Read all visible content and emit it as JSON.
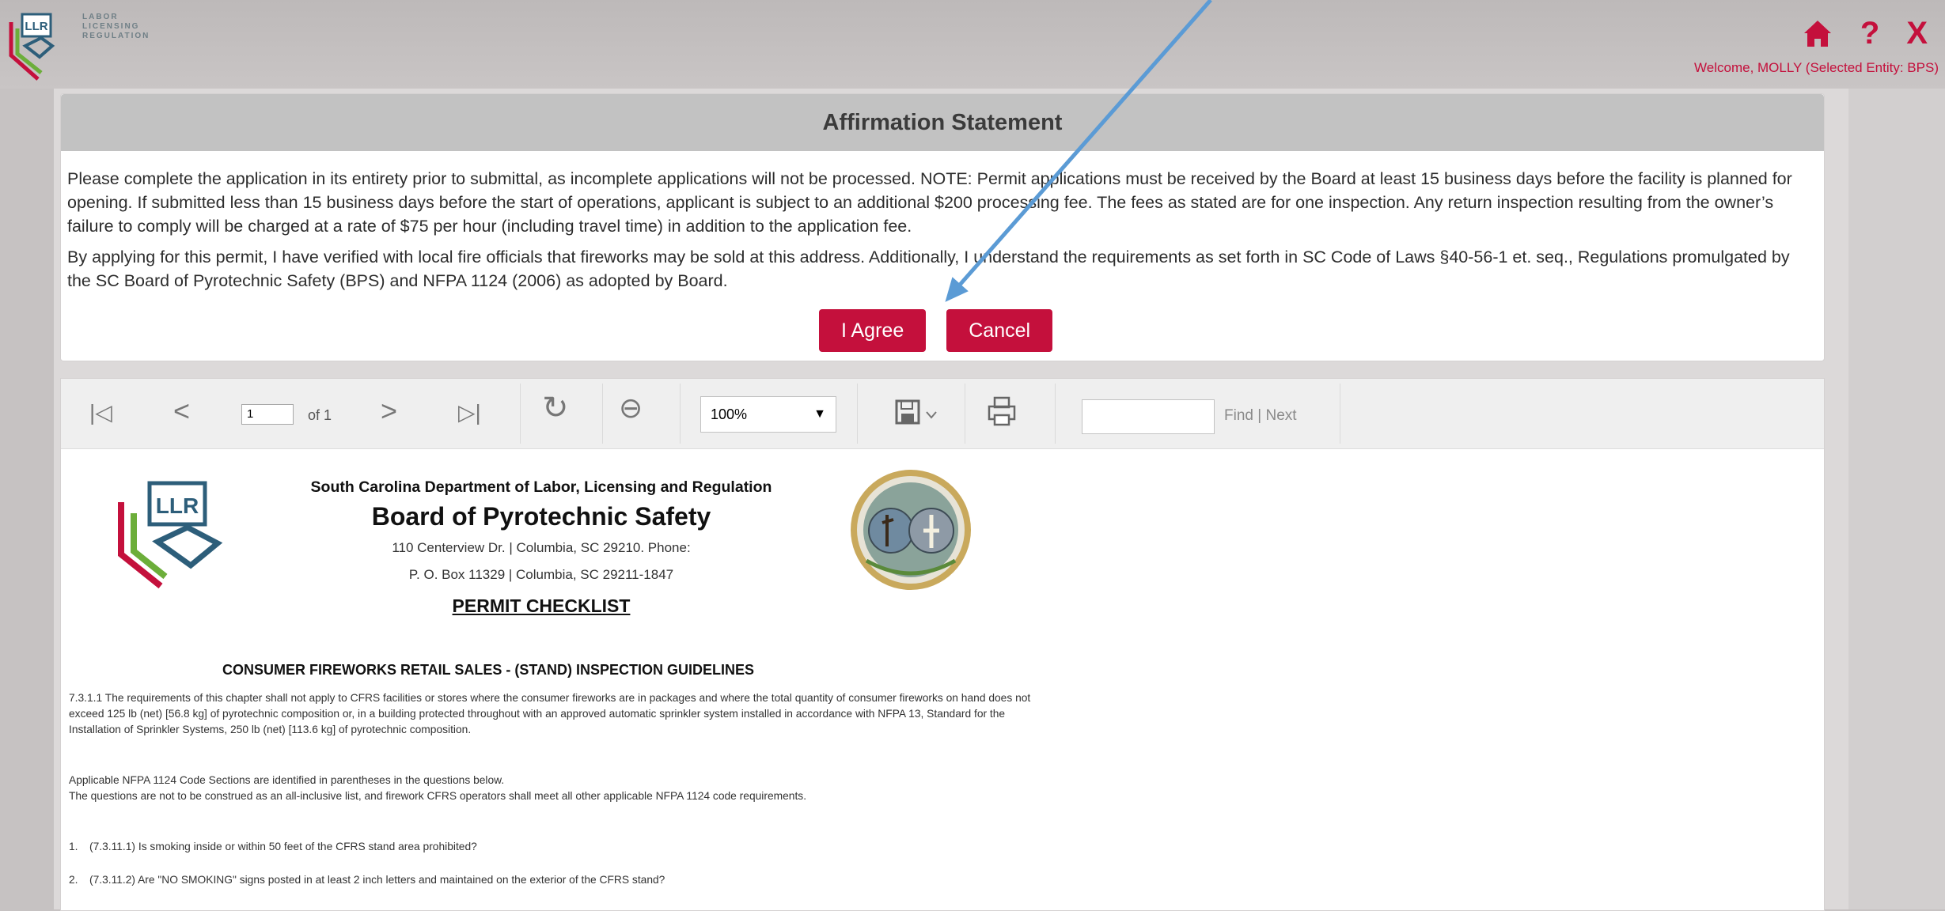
{
  "brand": {
    "logo_text": "LLR",
    "wordmark": "LABOR\nLICENSING\nREGULATION"
  },
  "header": {
    "home_icon": "home-icon",
    "help_symbol": "?",
    "close_symbol": "X",
    "welcome": "Welcome, MOLLY (Selected Entity: BPS)"
  },
  "affirmation": {
    "title": "Affirmation Statement",
    "paragraph1": "Please complete the application in its entirety prior to submittal, as incomplete applications will not be processed. NOTE: Permit applications must be received by the Board at least 15 business days before the facility is planned for opening. If submitted less than 15 business days before the start of operations, applicant is subject to an additional $200 processing fee. The fees as stated are for one inspection. Any return inspection resulting from the owner’s failure to comply will be charged at a rate of $75 per hour (including travel time) in addition to the application fee.",
    "paragraph2": "By applying for this permit, I have verified with local fire officials that fireworks may be sold at this address. Additionally, I understand the requirements as set forth in SC Code of Laws §40-56-1 et. seq., Regulations promulgated by the SC Board of Pyrotechnic Safety (BPS) and NFPA 1124 (2006) as adopted by Board.",
    "agree_label": "I Agree",
    "cancel_label": "Cancel"
  },
  "toolbar": {
    "first_page": "|◁",
    "prev_page": "<",
    "page_value": "1",
    "page_of": "of 1",
    "next_page": ">",
    "last_page": "▷|",
    "refresh": "↻",
    "back": "⊖",
    "zoom": "100%",
    "find_label": "Find",
    "separator": "|",
    "next_label": "Next"
  },
  "document": {
    "logo_text": "LLR",
    "department": "South Carolina Department of Labor, Licensing and Regulation",
    "board": "Board of Pyrotechnic Safety",
    "address1": "110 Centerview Dr. | Columbia, SC 29210. Phone:",
    "address2": "P. O. Box 11329 | Columbia, SC 29211-1847",
    "checklist_title": "PERMIT CHECKLIST",
    "guidelines_title": "CONSUMER FIREWORKS RETAIL SALES - (STAND) INSPECTION GUIDELINES",
    "intro": "7.3.1.1 The requirements of this chapter shall not apply to CFRS facilities or stores where the consumer fireworks are in packages and where the total quantity of consumer fireworks on hand does not exceed 125 lb (net) [56.8 kg] of pyrotechnic composition or, in a building protected throughout with an approved automatic sprinkler system installed in accordance with NFPA 13, Standard for the Installation of Sprinkler Systems, 250 lb (net) [113.6 kg] of pyrotechnic composition.",
    "applicable": "Applicable NFPA 1124 Code Sections are identified in parentheses in the questions below.",
    "not_inclusive": "The questions are not to be construed as an all-inclusive list, and firework CFRS operators shall meet all other applicable NFPA 1124 code requirements.",
    "questions": [
      {
        "num": "1.",
        "text": "(7.3.11.1) Is smoking inside or within 50 feet of the CFRS stand area prohibited?"
      },
      {
        "num": "2.",
        "text": "(7.3.11.2) Are \"NO SMOKING\" signs posted in at least 2 inch letters and maintained on the exterior of the CFRS stand?"
      }
    ]
  },
  "colors": {
    "accent": "#c4103c",
    "annotation_arrow": "#5b9bd5"
  }
}
